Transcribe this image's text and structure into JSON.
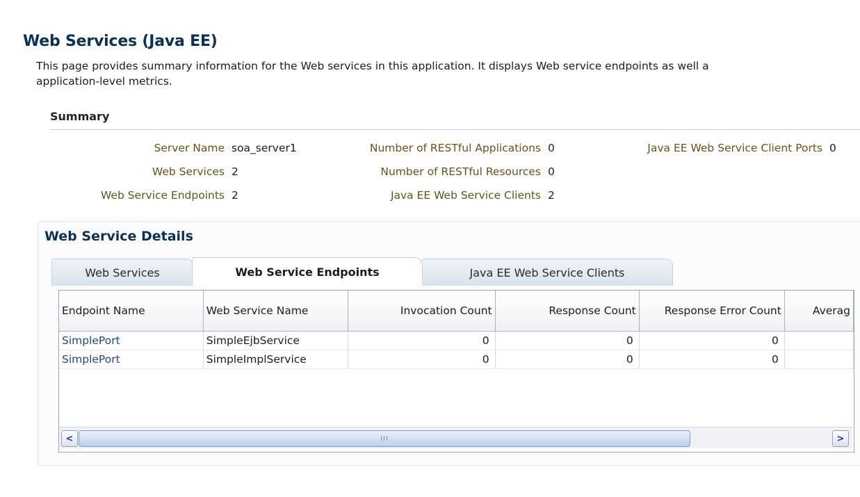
{
  "page": {
    "title": "Web Services (Java EE)",
    "description_line1": "This page provides summary information for the Web services in this application. It displays Web service endpoints as well a",
    "description_line2": "application-level metrics."
  },
  "summary": {
    "heading": "Summary",
    "items": {
      "server_name": {
        "label": "Server Name",
        "value": "soa_server1"
      },
      "web_services": {
        "label": "Web Services",
        "value": "2"
      },
      "ws_endpoints": {
        "label": "Web Service Endpoints",
        "value": "2"
      },
      "restful_apps": {
        "label": "Number of RESTful Applications",
        "value": "0"
      },
      "restful_resources": {
        "label": "Number of RESTful Resources",
        "value": "0"
      },
      "javaee_clients": {
        "label": "Java EE Web Service Clients",
        "value": "2"
      },
      "javaee_client_ports": {
        "label": "Java EE Web Service Client Ports",
        "value": "0"
      }
    }
  },
  "details": {
    "heading": "Web Service Details",
    "tabs": [
      {
        "label": "Web Services",
        "active": false
      },
      {
        "label": "Web Service Endpoints",
        "active": true
      },
      {
        "label": "Java EE Web Service Clients",
        "active": false
      }
    ],
    "table": {
      "columns": [
        "Endpoint Name",
        "Web Service Name",
        "Invocation Count",
        "Response Count",
        "Response Error Count",
        "Averag"
      ],
      "rows": [
        [
          "SimplePort",
          "SimpleEjbService",
          "0",
          "0",
          "0",
          ""
        ],
        [
          "SimplePort",
          "SimpleImplService",
          "0",
          "0",
          "0",
          ""
        ]
      ]
    },
    "scrollbar": {
      "thumb_grip": "III",
      "left_arrow": "<",
      "right_arrow": ">"
    }
  }
}
